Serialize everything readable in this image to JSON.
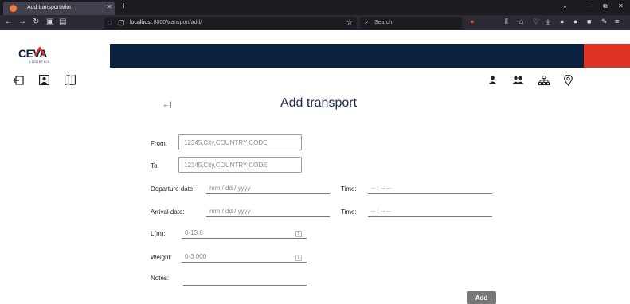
{
  "browser": {
    "tab_title": "Add transportation",
    "url_host": "localhost",
    "url_path": ":8000/transport/add/",
    "search_placeholder": "Search"
  },
  "header": {
    "logo_text": "CEVA",
    "logo_subtext": "LOGISTICS",
    "colors": {
      "navy": "#0a2240",
      "red": "#e03324"
    }
  },
  "page": {
    "title": "Add transport",
    "back_glyph": "←|"
  },
  "form": {
    "from_label": "From:",
    "from_placeholder": "12345,City,COUNTRY CODE",
    "to_label": "To:",
    "to_placeholder": "12345,City,COUNTRY CODE",
    "departure_label": "Departure date:",
    "departure_value": "mm / dd / yyyy",
    "departure_time_label": "Time:",
    "departure_time_value": "-- : -- --",
    "arrival_label": "Arrival date:",
    "arrival_value": "mm / dd / yyyy",
    "arrival_time_label": "Time:",
    "arrival_time_value": "-- : -- --",
    "length_label": "L(m):",
    "length_placeholder": "0-13.6",
    "weight_label": "Weight:",
    "weight_placeholder": "0-3 000",
    "notes_label": "Notes:",
    "submit_label": "Add"
  }
}
